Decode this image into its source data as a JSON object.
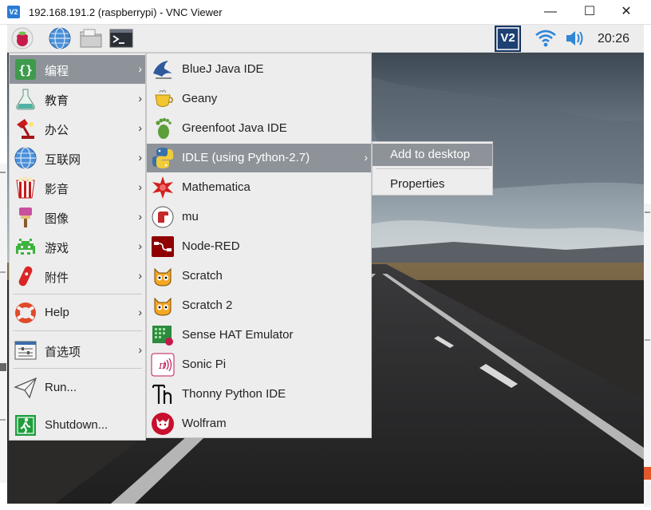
{
  "window": {
    "title": "192.168.191.2 (raspberrypi) - VNC Viewer",
    "app_icon": "V2",
    "minimize": "—",
    "maximize": "☐",
    "close": "✕"
  },
  "panel": {
    "clock": "20:26",
    "launchers": [
      "raspberry-menu-icon",
      "globe-icon",
      "folder-icon",
      "terminal-icon"
    ],
    "tray": [
      "vnc-icon",
      "wifi-icon",
      "volume-icon"
    ],
    "vnc_label": "V2"
  },
  "main_menu": {
    "items": [
      {
        "label": "编程",
        "icon": "programming-icon",
        "arrow": "›",
        "selected": true
      },
      {
        "label": "教育",
        "icon": "education-icon",
        "arrow": "›"
      },
      {
        "label": "办公",
        "icon": "office-icon",
        "arrow": "›"
      },
      {
        "label": "互联网",
        "icon": "internet-icon",
        "arrow": "›"
      },
      {
        "label": "影音",
        "icon": "media-icon",
        "arrow": "›"
      },
      {
        "label": "图像",
        "icon": "graphics-icon",
        "arrow": "›"
      },
      {
        "label": "游戏",
        "icon": "games-icon",
        "arrow": "›"
      },
      {
        "label": "附件",
        "icon": "accessories-icon",
        "arrow": "›"
      },
      {
        "label": "Help",
        "icon": "help-icon",
        "arrow": "›"
      },
      {
        "label": "首选项",
        "icon": "preferences-icon",
        "arrow": "›"
      },
      {
        "label": "Run...",
        "icon": "run-icon"
      },
      {
        "label": "Shutdown...",
        "icon": "shutdown-icon"
      }
    ]
  },
  "sub_menu": {
    "items": [
      {
        "label": "BlueJ Java IDE",
        "icon": "bluej-icon"
      },
      {
        "label": "Geany",
        "icon": "geany-icon"
      },
      {
        "label": "Greenfoot Java IDE",
        "icon": "greenfoot-icon"
      },
      {
        "label": "IDLE (using Python-2.7)",
        "icon": "python-icon",
        "arrow": "›",
        "selected": true
      },
      {
        "label": "Mathematica",
        "icon": "mathematica-icon"
      },
      {
        "label": "mu",
        "icon": "mu-icon"
      },
      {
        "label": "Node-RED",
        "icon": "node-red-icon"
      },
      {
        "label": "Scratch",
        "icon": "scratch-icon"
      },
      {
        "label": "Scratch 2",
        "icon": "scratch2-icon"
      },
      {
        "label": "Sense HAT Emulator",
        "icon": "sense-hat-icon"
      },
      {
        "label": "Sonic Pi",
        "icon": "sonic-pi-icon"
      },
      {
        "label": "Thonny Python IDE",
        "icon": "thonny-icon"
      },
      {
        "label": "Wolfram",
        "icon": "wolfram-icon"
      }
    ]
  },
  "context_menu": {
    "items": [
      {
        "label": "Add to desktop",
        "selected": true
      },
      {
        "label": "Properties"
      }
    ]
  },
  "colors": {
    "menu_bg": "#ededed",
    "selected_bg": "#8d9399",
    "panel_bg": "#ededed"
  }
}
